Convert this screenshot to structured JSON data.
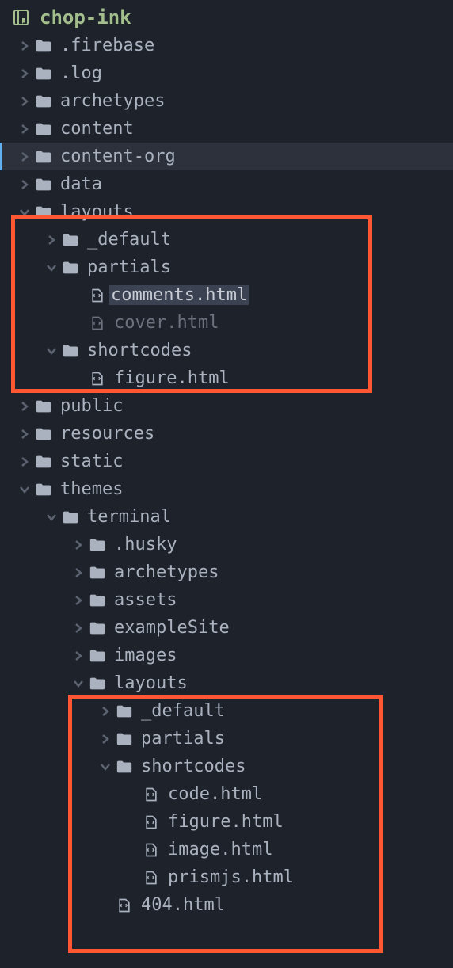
{
  "root": {
    "label": "chop-ink"
  },
  "nodes": [
    {
      "indent": 0,
      "chevron": "right",
      "type": "folder",
      "label": ".firebase"
    },
    {
      "indent": 0,
      "chevron": "right",
      "type": "folder",
      "label": ".log"
    },
    {
      "indent": 0,
      "chevron": "right",
      "type": "folder",
      "label": "archetypes"
    },
    {
      "indent": 0,
      "chevron": "right",
      "type": "folder",
      "label": "content"
    },
    {
      "indent": 0,
      "chevron": "right",
      "type": "folder",
      "label": "content-org",
      "hover": true
    },
    {
      "indent": 0,
      "chevron": "right",
      "type": "folder",
      "label": "data"
    },
    {
      "indent": 0,
      "chevron": "down",
      "type": "folder",
      "label": "layouts"
    },
    {
      "indent": 1,
      "chevron": "right",
      "type": "folder",
      "label": "_default"
    },
    {
      "indent": 1,
      "chevron": "down",
      "type": "folder",
      "label": "partials"
    },
    {
      "indent": 2,
      "chevron": "",
      "type": "file-code",
      "label": "comments.html",
      "selected": true
    },
    {
      "indent": 2,
      "chevron": "",
      "type": "file-code",
      "label": "cover.html",
      "dim": true
    },
    {
      "indent": 1,
      "chevron": "down",
      "type": "folder",
      "label": "shortcodes"
    },
    {
      "indent": 2,
      "chevron": "",
      "type": "file-code",
      "label": "figure.html"
    },
    {
      "indent": 0,
      "chevron": "right",
      "type": "folder",
      "label": "public"
    },
    {
      "indent": 0,
      "chevron": "right",
      "type": "folder",
      "label": "resources"
    },
    {
      "indent": 0,
      "chevron": "right",
      "type": "folder",
      "label": "static"
    },
    {
      "indent": 0,
      "chevron": "down",
      "type": "folder",
      "label": "themes"
    },
    {
      "indent": 1,
      "chevron": "down",
      "type": "folder",
      "label": "terminal"
    },
    {
      "indent": 2,
      "chevron": "right",
      "type": "folder",
      "label": ".husky"
    },
    {
      "indent": 2,
      "chevron": "right",
      "type": "folder",
      "label": "archetypes"
    },
    {
      "indent": 2,
      "chevron": "right",
      "type": "folder",
      "label": "assets"
    },
    {
      "indent": 2,
      "chevron": "right",
      "type": "folder",
      "label": "exampleSite"
    },
    {
      "indent": 2,
      "chevron": "right",
      "type": "folder",
      "label": "images"
    },
    {
      "indent": 2,
      "chevron": "down",
      "type": "folder",
      "label": "layouts"
    },
    {
      "indent": 3,
      "chevron": "right",
      "type": "folder",
      "label": "_default"
    },
    {
      "indent": 3,
      "chevron": "right",
      "type": "folder",
      "label": "partials"
    },
    {
      "indent": 3,
      "chevron": "down",
      "type": "folder",
      "label": "shortcodes"
    },
    {
      "indent": 4,
      "chevron": "",
      "type": "file-code",
      "label": "code.html"
    },
    {
      "indent": 4,
      "chevron": "",
      "type": "file-code",
      "label": "figure.html"
    },
    {
      "indent": 4,
      "chevron": "",
      "type": "file-code",
      "label": "image.html"
    },
    {
      "indent": 4,
      "chevron": "",
      "type": "file-code",
      "label": "prismjs.html"
    },
    {
      "indent": 3,
      "chevron": "",
      "type": "file-code",
      "label": "404.html"
    }
  ]
}
